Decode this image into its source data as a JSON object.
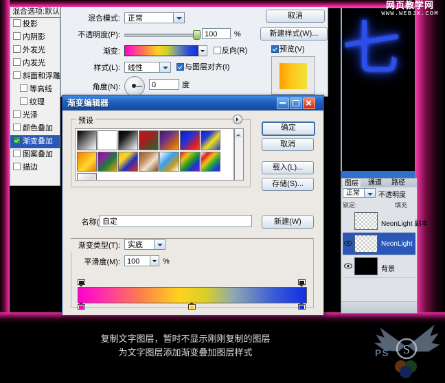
{
  "watermark": {
    "title": "网页教学网",
    "url": "WWW.WEBJX.COM"
  },
  "caption": {
    "line1": "复制文字图层，暂时不显示刚刚复制的图层",
    "line2": "为文字图层添加渐变叠加图层样式"
  },
  "canvas": {
    "text": "七"
  },
  "style_list": {
    "header": "混合选项:默认",
    "items": [
      {
        "label": "投影",
        "checked": false,
        "indent": false
      },
      {
        "label": "内阴影",
        "checked": false,
        "indent": false
      },
      {
        "label": "外发光",
        "checked": false,
        "indent": false
      },
      {
        "label": "内发光",
        "checked": false,
        "indent": false
      },
      {
        "label": "斜面和浮雕",
        "checked": false,
        "indent": false
      },
      {
        "label": "等高线",
        "checked": false,
        "indent": true
      },
      {
        "label": "纹理",
        "checked": false,
        "indent": true
      },
      {
        "label": "光泽",
        "checked": false,
        "indent": false
      },
      {
        "label": "颜色叠加",
        "checked": false,
        "indent": false
      },
      {
        "label": "渐变叠加",
        "checked": true,
        "indent": false,
        "selected": true
      },
      {
        "label": "图案叠加",
        "checked": false,
        "indent": false
      },
      {
        "label": "描边",
        "checked": false,
        "indent": false
      }
    ]
  },
  "layer_style": {
    "blend_mode_label": "混合模式:",
    "blend_mode_value": "正常",
    "opacity_label": "不透明度(P):",
    "opacity_value": "100",
    "opacity_unit": "%",
    "gradient_label": "渐变:",
    "reverse_label": "反向(R)",
    "reverse_checked": false,
    "style_label": "样式(L):",
    "style_value": "线性",
    "align_label": "与图层对齐(I)",
    "align_checked": true,
    "angle_label": "角度(N):",
    "angle_value": "0",
    "angle_unit": "度",
    "cancel_label": "取消",
    "new_style_label": "新建样式(W)...",
    "preview_label": "预览(V)",
    "preview_checked": true
  },
  "gradient_editor": {
    "title": "渐变编辑器",
    "presets_label": "预设",
    "buttons": {
      "ok": "确定",
      "cancel": "取消",
      "load": "载入(L)...",
      "save": "存储(S)...",
      "new": "新建(W)"
    },
    "name_label": "名称(N):",
    "name_value": "自定",
    "type_label": "渐变类型(T):",
    "type_value": "实底",
    "smoothness_label": "平滑度(M):",
    "smoothness_value": "100",
    "smoothness_unit": "%",
    "presets": [
      "linear-gradient(135deg,#000 0%,#2a2a2a 18%,#ffffff 100%)",
      "linear-gradient(135deg,#ffffff 0%,#ffffff 45%,rgba(255,255,255,0) 100%)",
      "linear-gradient(135deg,#000000 0%,#1a1a1a 30%,#ffffff 100%)",
      "linear-gradient(135deg,#c81414 0%,#a02020 40%,#1c6b2a 100%)",
      "linear-gradient(135deg,#3a1f5e 0%,#6b2f8a 35%,#d06a12 75%,#f0a018 100%)",
      "linear-gradient(135deg,#1018c8 0%,#2030d8 38%,#e02020 78%,#f04a18 100%)",
      "linear-gradient(135deg,#1020c8 0%,#2838d8 30%,#f0e018 58%,#1840d0 100%)",
      "linear-gradient(135deg,#f08000 0%,#ffb81a 40%,#ffd830 60%,#e87a10 100%)",
      "linear-gradient(135deg,#6a1a8a 0%,#9020a8 25%,#1c7a3a 55%,#e8a018 100%)",
      "linear-gradient(135deg,#f0c010 0%,#ffd820 30%,#2030c0 60%,#e03018 100%)",
      "linear-gradient(135deg,#8a5a30 0%,#c89060 35%,#f0e0cc 60%,#7a4a24 100%)",
      "linear-gradient(135deg,#ffffff 0%,#3aa0e8 40%,#c89a20 70%,#ffffff 100%)",
      "linear-gradient(135deg,#e01818 0%,#f0c018 25%,#20a020 50%,#2030d0 75%,#8020c0 100%)",
      "linear-gradient(135deg,#ffffff 0%,#e02020 20%,#f0c018 40%,#20a838 62%,#2038d8 85%)",
      "linear-gradient(135deg,#ffffff 0%,#dddddd 50%,#ffffff 100%)"
    ],
    "gradient_bar": "linear-gradient(90deg,#ff00cc 0%,#ff34a6 12%,#fb7d4e 27%,#ffd21e 44%,#d8cf27 56%,#8fa9b0 68%,#3a5ad6 86%,#0f2fe2 100%)",
    "color_stops": [
      {
        "position": 0,
        "color": "#ff00cc"
      },
      {
        "position": 50,
        "color": "#ffd21e"
      },
      {
        "position": 100,
        "color": "#1030e0"
      }
    ],
    "opacity_stops": [
      {
        "position": 0,
        "color": "#1a1a1a"
      },
      {
        "position": 100,
        "color": "#1a1a1a"
      }
    ]
  },
  "layers_panel": {
    "tabs": [
      {
        "label": "图层",
        "active": true
      },
      {
        "label": "通道",
        "active": false
      },
      {
        "label": "路径",
        "active": false
      }
    ],
    "blend_mode": "正常",
    "opacity_label": "不透明度",
    "lock_label": "锁定:",
    "fill_label": "填充",
    "layers": [
      {
        "name": "NeonLight 副本",
        "visible": false,
        "selected": false,
        "thumb": "checker"
      },
      {
        "name": "NeonLight",
        "visible": true,
        "selected": true,
        "thumb": "checker"
      },
      {
        "name": "背景",
        "visible": true,
        "selected": false,
        "thumb": "black"
      }
    ]
  },
  "colors": {
    "accent_pink": "#e52a9a",
    "dialog_blue": "#1f5fbd",
    "selection_blue": "#2b58b8"
  }
}
